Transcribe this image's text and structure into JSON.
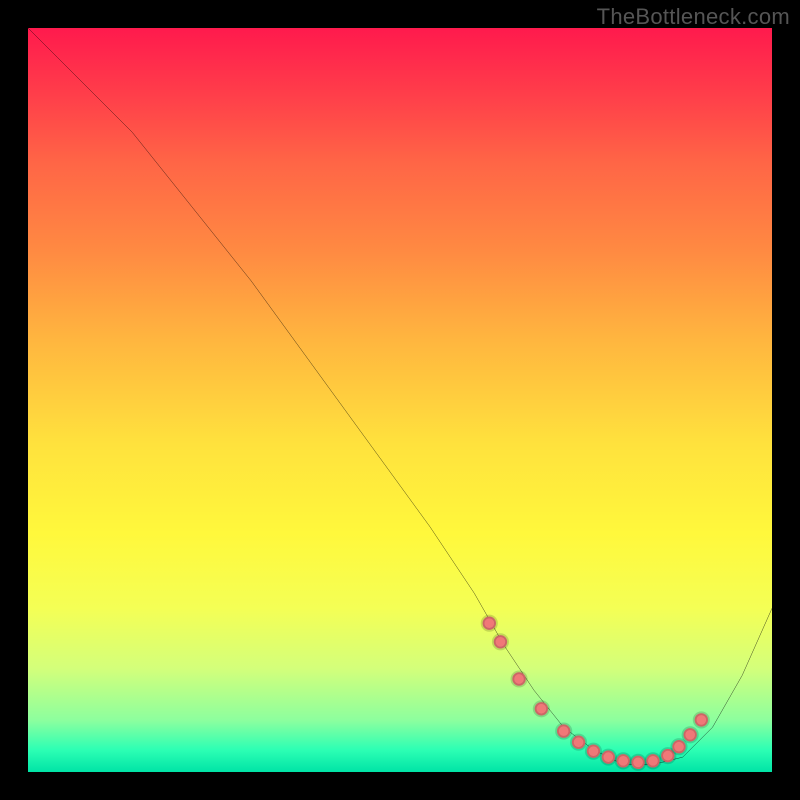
{
  "watermark": "TheBottleneck.com",
  "chart_data": {
    "type": "line",
    "title": "",
    "xlabel": "",
    "ylabel": "",
    "xlim": [
      0,
      100
    ],
    "ylim": [
      0,
      100
    ],
    "background_gradient_stops": [
      {
        "pct": 0,
        "color": "#ff1a4d"
      },
      {
        "pct": 9,
        "color": "#ff3e4a"
      },
      {
        "pct": 18,
        "color": "#ff6546"
      },
      {
        "pct": 30,
        "color": "#ff8a42"
      },
      {
        "pct": 42,
        "color": "#ffb63f"
      },
      {
        "pct": 56,
        "color": "#ffe23d"
      },
      {
        "pct": 68,
        "color": "#fff83c"
      },
      {
        "pct": 78,
        "color": "#f4ff55"
      },
      {
        "pct": 86,
        "color": "#d4ff7a"
      },
      {
        "pct": 93,
        "color": "#8dff9e"
      },
      {
        "pct": 97,
        "color": "#2dffb4"
      },
      {
        "pct": 100,
        "color": "#00e4a6"
      }
    ],
    "series": [
      {
        "name": "curve",
        "x": [
          0,
          4,
          8,
          14,
          22,
          30,
          38,
          46,
          54,
          60,
          64,
          68,
          72,
          76,
          80,
          84,
          88,
          92,
          96,
          100
        ],
        "y": [
          100,
          96,
          92,
          86,
          76,
          66,
          55,
          44,
          33,
          24,
          17,
          11,
          6,
          3,
          1,
          1,
          2,
          6,
          13,
          22
        ]
      }
    ],
    "markers": {
      "name": "dots",
      "color": "#f07878",
      "x": [
        62,
        63.5,
        66,
        69,
        72,
        74,
        76,
        78,
        80,
        82,
        84,
        86,
        87.5,
        89,
        90.5
      ],
      "y": [
        20,
        17.5,
        12.5,
        8.5,
        5.5,
        4,
        2.8,
        2,
        1.5,
        1.3,
        1.5,
        2.2,
        3.4,
        5,
        7
      ]
    }
  }
}
